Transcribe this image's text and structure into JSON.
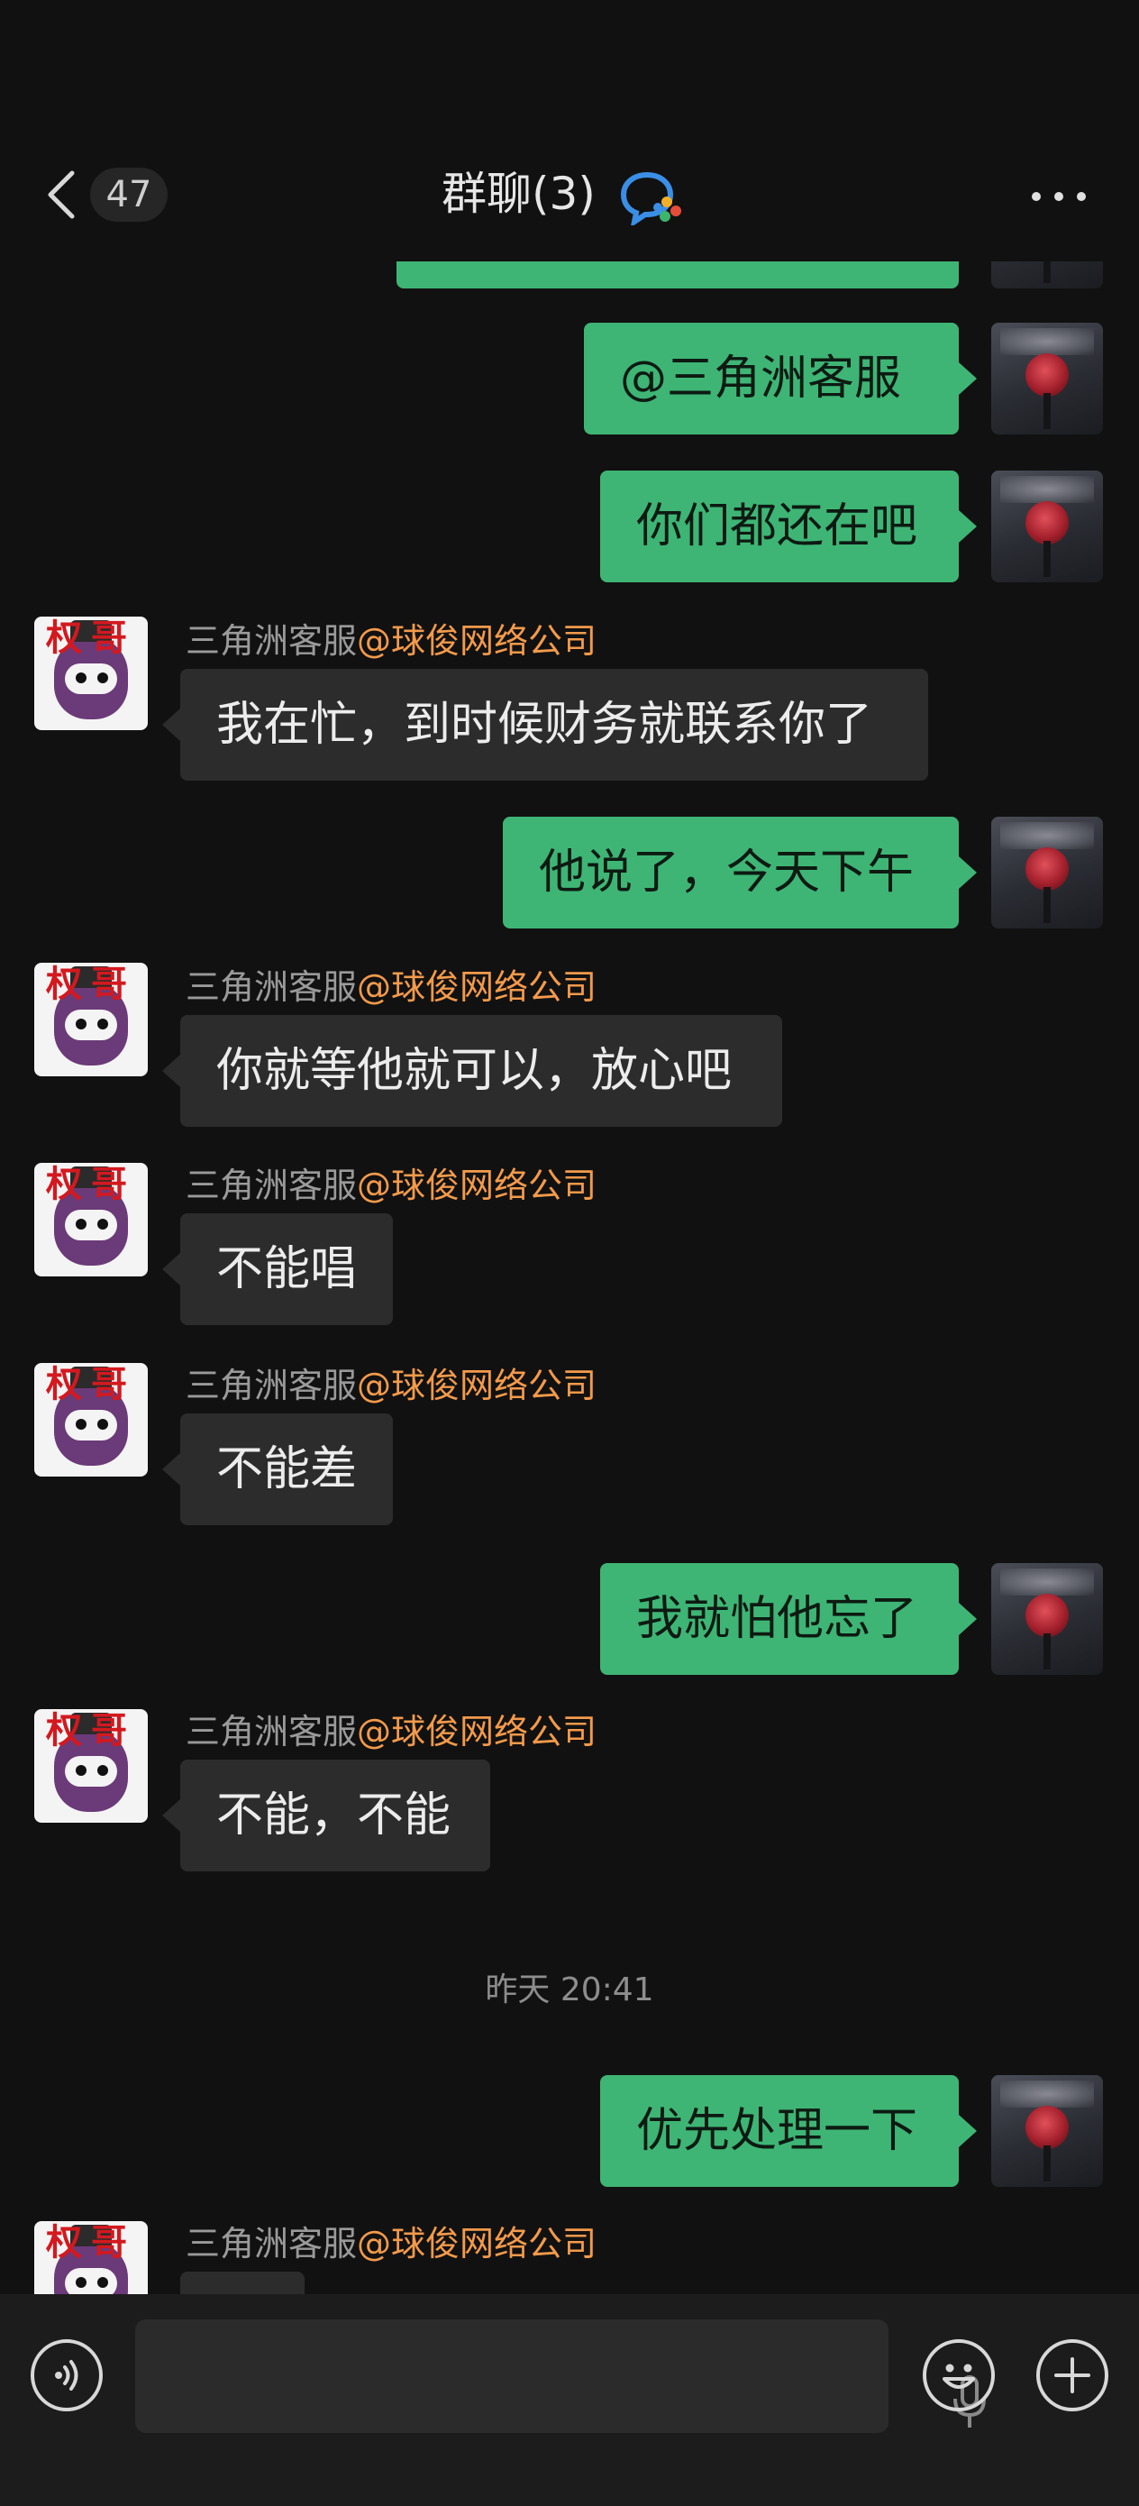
{
  "header": {
    "back_icon": "chevron-left-icon",
    "unread_count": "47",
    "title": "群聊(3)",
    "title_icon": "enterprise-chat-icon",
    "more_icon": "more-icon"
  },
  "messages": [
    {
      "side": "me",
      "text": "@三角洲客服"
    },
    {
      "side": "me",
      "text": "你们都还在吧"
    },
    {
      "side": "them",
      "sender": "三角洲客服",
      "org": "@球俊网络公司",
      "text": "我在忙，到时候财务就联系你了"
    },
    {
      "side": "me",
      "text": "他说了，今天下午"
    },
    {
      "side": "them",
      "sender": "三角洲客服",
      "org": "@球俊网络公司",
      "text": "你就等他就可以，放心吧"
    },
    {
      "side": "them",
      "sender": "三角洲客服",
      "org": "@球俊网络公司",
      "text": "不能唱"
    },
    {
      "side": "them",
      "sender": "三角洲客服",
      "org": "@球俊网络公司",
      "text": "不能差"
    },
    {
      "side": "me",
      "text": "我就怕他忘了"
    },
    {
      "side": "them",
      "sender": "三角洲客服",
      "org": "@球俊网络公司",
      "text": "不能，不能"
    },
    {
      "side": "me",
      "text": "优先处理一下"
    },
    {
      "side": "them",
      "sender": "三角洲客服",
      "org": "@球俊网络公司",
      "text": ""
    }
  ],
  "timestamp": "昨天 20:41",
  "avatar_them_text": "权哥",
  "bottom": {
    "voice_icon": "voice-icon",
    "mic_icon": "microphone-icon",
    "emoji_icon": "emoji-icon",
    "plus_icon": "plus-icon"
  },
  "colors": {
    "background": "#111111",
    "my_bubble": "#3eb575",
    "their_bubble": "#2c2c2c",
    "org_name": "#f39a4b"
  }
}
